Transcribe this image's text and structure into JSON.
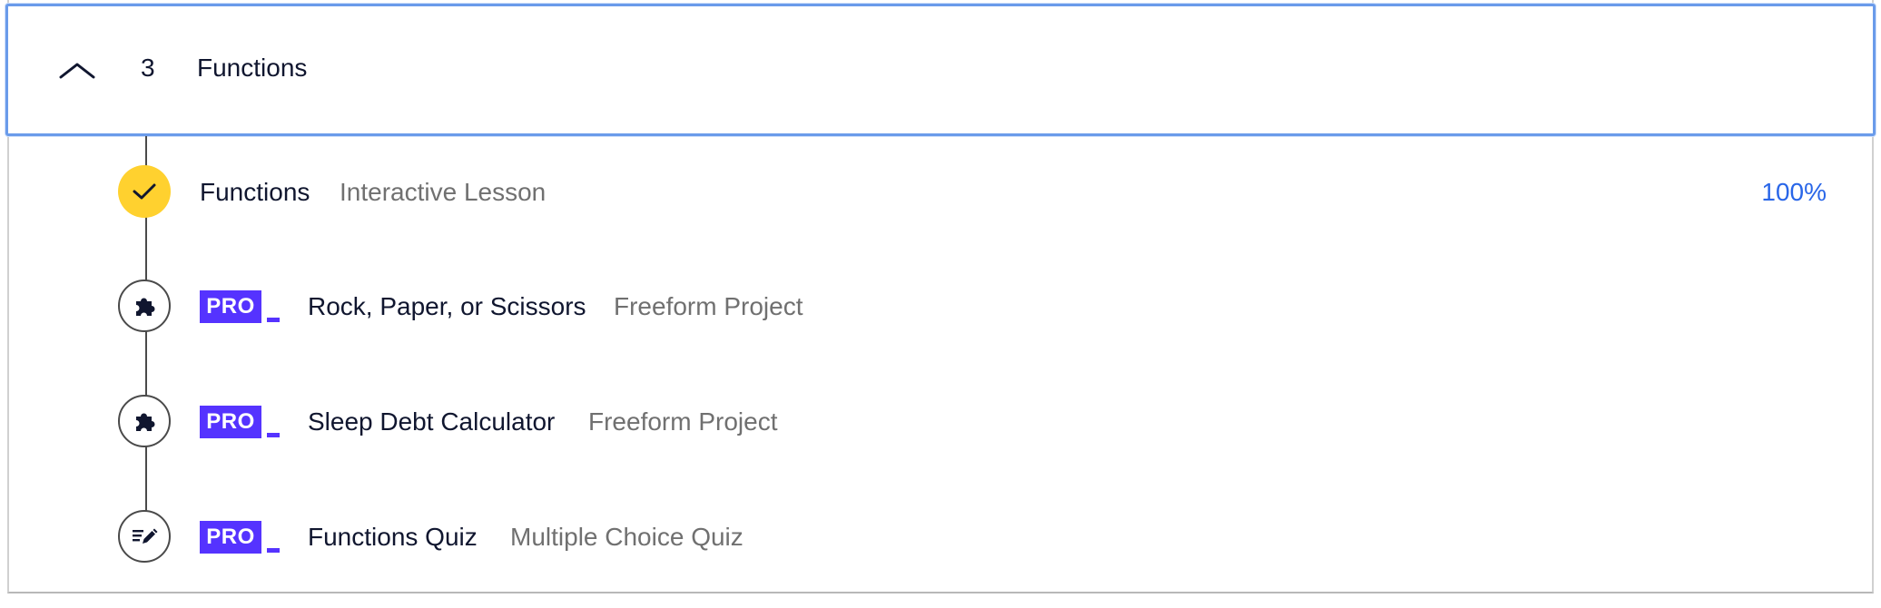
{
  "module": {
    "number": "3",
    "title": "Functions",
    "expanded": true
  },
  "items": [
    {
      "title": "Functions",
      "type": "Interactive Lesson",
      "status": "complete",
      "icon": "check-icon",
      "pro": false,
      "progress": "100%"
    },
    {
      "title": "Rock, Paper, or Scissors",
      "type": "Freeform Project",
      "status": "locked",
      "icon": "puzzle-icon",
      "pro": true,
      "badge": "PRO"
    },
    {
      "title": "Sleep Debt Calculator",
      "type": "Freeform Project",
      "status": "locked",
      "icon": "puzzle-icon",
      "pro": true,
      "badge": "PRO"
    },
    {
      "title": "Functions Quiz",
      "type": "Multiple Choice Quiz",
      "status": "locked",
      "icon": "quiz-pencil-icon",
      "pro": true,
      "badge": "PRO"
    }
  ],
  "colors": {
    "accent_blue": "#2966e8",
    "pro_purple": "#5533ff",
    "complete_yellow": "#ffd12f",
    "focus_border": "#6a9bea"
  }
}
